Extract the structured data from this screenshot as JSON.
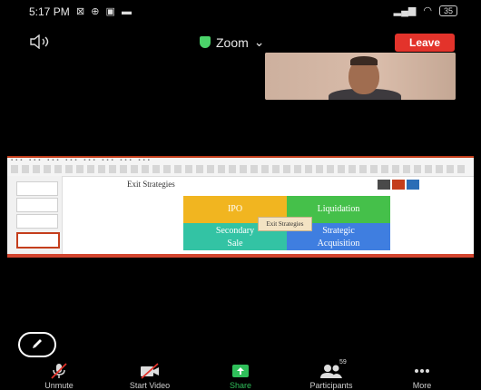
{
  "status_bar": {
    "time": "5:17 PM",
    "indicators": [
      "notification-icon",
      "gps-icon",
      "video-icon",
      "mail-icon"
    ],
    "battery": "35"
  },
  "header": {
    "app_title": "Zoom",
    "leave_label": "Leave",
    "leave_color": "#e3332b",
    "shield_color": "#4bd36a"
  },
  "slide": {
    "title": "Exit Strategies",
    "center_label": "Exit Strategies",
    "quadrants": [
      {
        "label": "IPO",
        "color": "#f1b520"
      },
      {
        "label": "Liquidation",
        "color": "#45c04a"
      },
      {
        "label_line1": "Secondary",
        "label_line2": "Sale",
        "color": "#33c3a4"
      },
      {
        "label_line1": "Strategic",
        "label_line2": "Acquisition",
        "color": "#3f7ee0"
      }
    ]
  },
  "toolbar": {
    "unmute": "Unmute",
    "start_video": "Start Video",
    "share": "Share",
    "participants": "Participants",
    "participants_count": "59",
    "more": "More",
    "active_color": "#2fbf5a"
  }
}
